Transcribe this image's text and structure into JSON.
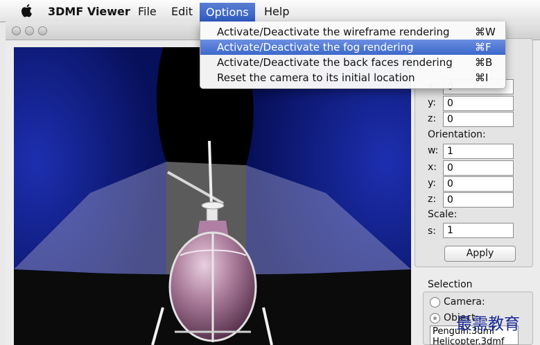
{
  "menubar": {
    "app_name": "3DMF Viewer",
    "menus": [
      "File",
      "Edit",
      "Options",
      "Help"
    ]
  },
  "options_menu": {
    "items": [
      {
        "label": "Activate/Deactivate the wireframe rendering",
        "shortcut": "⌘W"
      },
      {
        "label": "Activate/Deactivate the fog rendering",
        "shortcut": "⌘F"
      },
      {
        "label": "Activate/Deactivate the back faces rendering",
        "shortcut": "⌘B"
      },
      {
        "label": "Reset the camera to its initial location",
        "shortcut": "⌘I"
      }
    ]
  },
  "panel": {
    "position": {
      "x_label": "x:",
      "x_value": "0",
      "y_label": "y:",
      "y_value": "0",
      "z_label": "z:",
      "z_value": "0"
    },
    "orientation": {
      "title": "Orientation:",
      "w_label": "w:",
      "w_value": "1",
      "x_label": "x:",
      "x_value": "0",
      "y_label": "y:",
      "y_value": "0",
      "z_label": "z:",
      "z_value": "0"
    },
    "scale": {
      "title": "Scale:",
      "s_label": "s:",
      "s_value": "1"
    },
    "apply_label": "Apply"
  },
  "selection": {
    "title": "Selection",
    "camera_label": "Camera:",
    "object_label": "Object:",
    "object_selected": true,
    "objects": [
      "Penguin.3dmf",
      "Helicopter.3dmf"
    ]
  },
  "watermark": "最需教育",
  "colors": {
    "menu_highlight": "#3d68cb",
    "viewport_bg": "#0a1a8a",
    "fuselage": "#b78fae"
  }
}
